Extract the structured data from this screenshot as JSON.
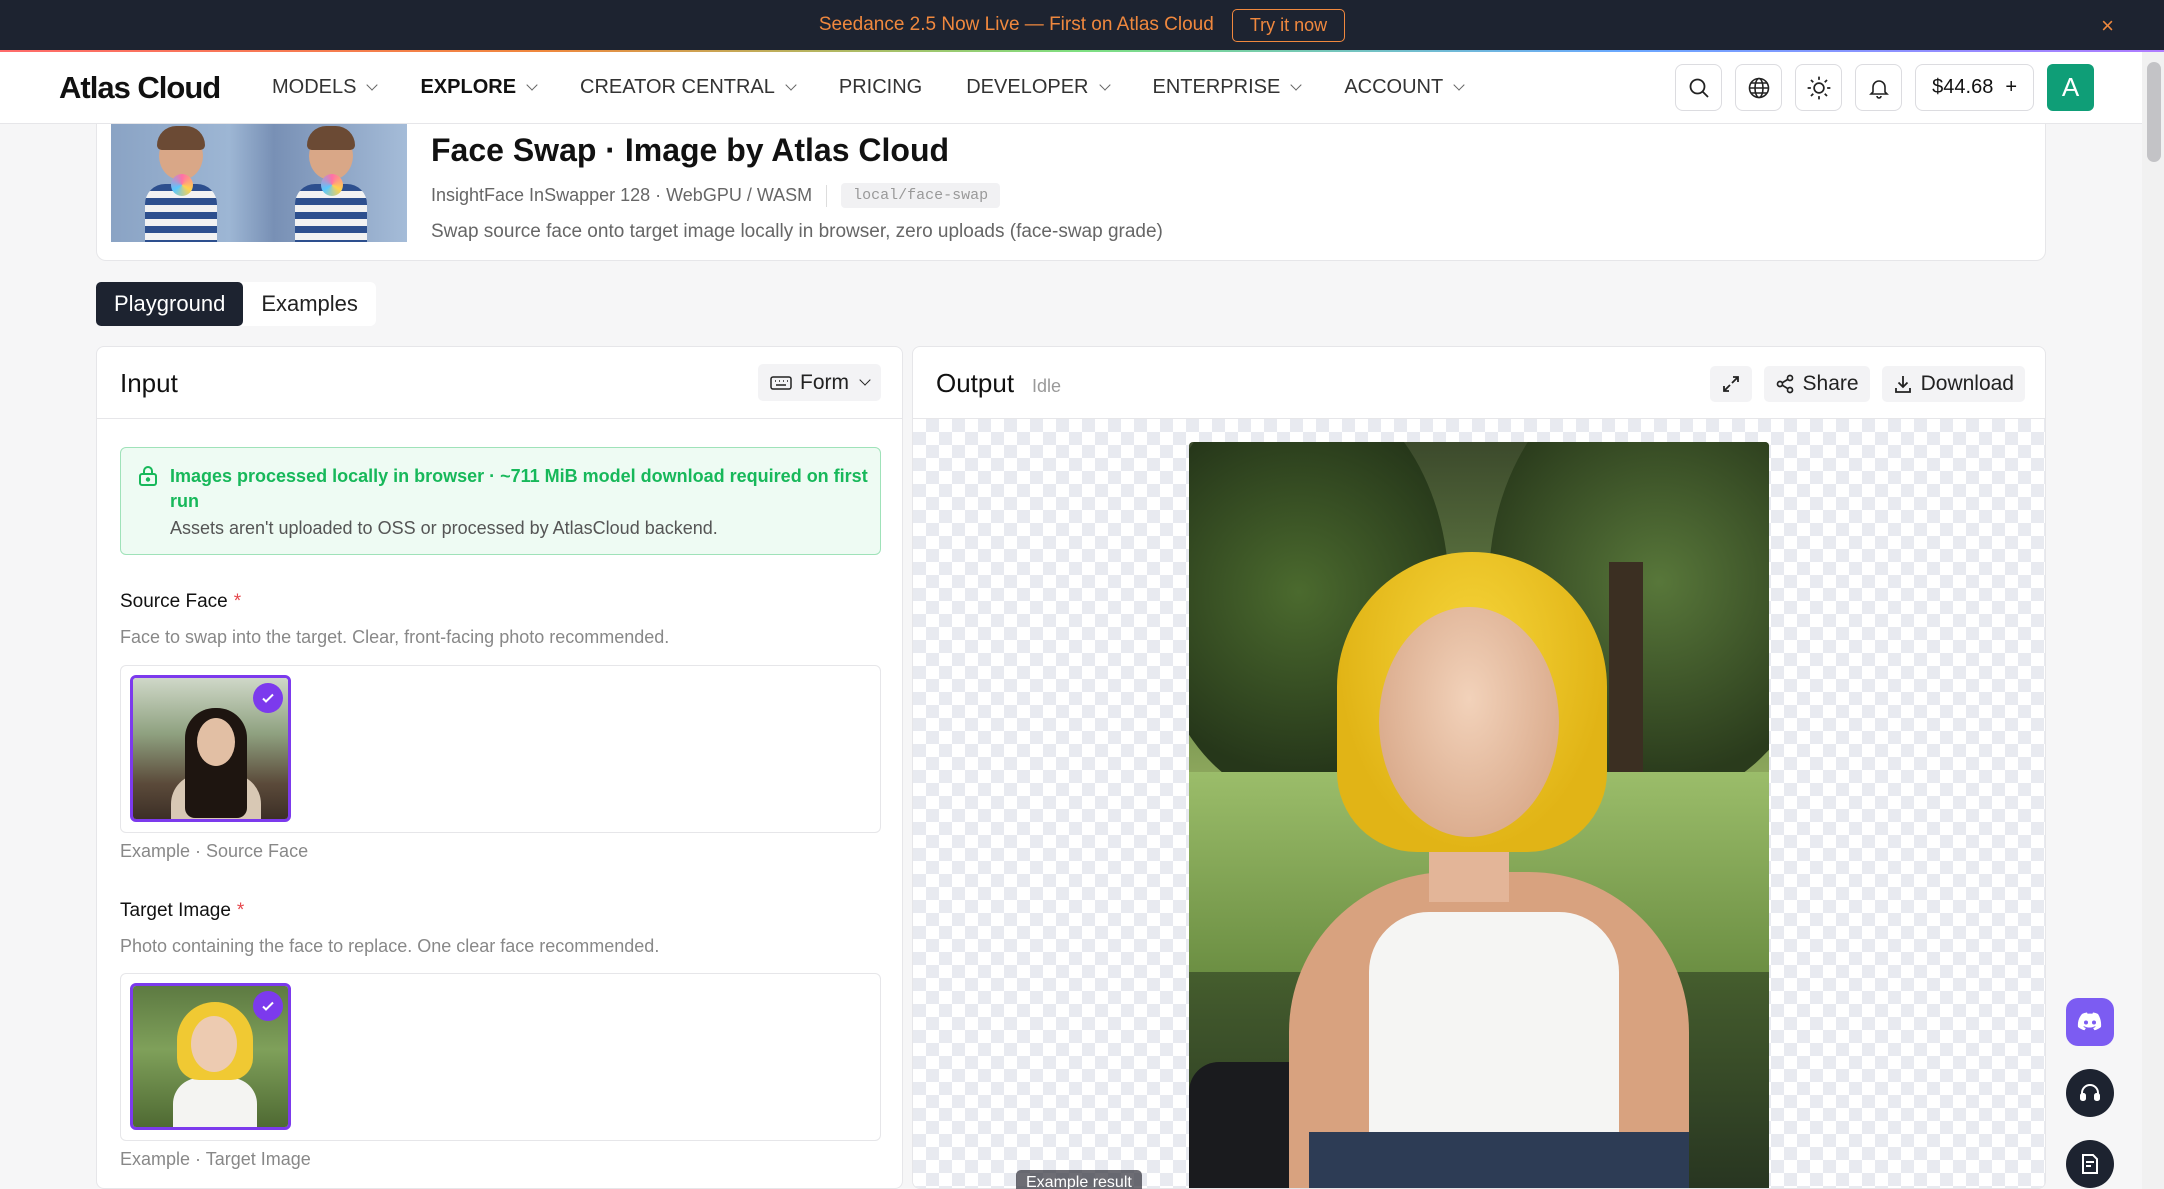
{
  "announcement": {
    "message": "Seedance 2.5 Now Live — First on Atlas Cloud",
    "cta": "Try it now",
    "close": "×"
  },
  "nav": {
    "logo": "Atlas Cloud",
    "items": [
      {
        "label": "MODELS",
        "dropdown": true
      },
      {
        "label": "EXPLORE",
        "dropdown": true,
        "active": true
      },
      {
        "label": "CREATOR CENTRAL",
        "dropdown": true
      },
      {
        "label": "PRICING",
        "dropdown": false
      },
      {
        "label": "DEVELOPER",
        "dropdown": true
      },
      {
        "label": "ENTERPRISE",
        "dropdown": true
      },
      {
        "label": "ACCOUNT",
        "dropdown": true
      }
    ],
    "balance": "$44.68",
    "balance_add": "+",
    "avatar_initial": "A"
  },
  "model": {
    "title": "Face Swap · Image by Atlas Cloud",
    "meta": "InsightFace InSwapper 128 · WebGPU / WASM",
    "slug": "local/face-swap",
    "description": "Swap source face onto target image locally in browser, zero uploads (face-swap grade)"
  },
  "tabs": [
    "Playground",
    "Examples"
  ],
  "input": {
    "title": "Input",
    "mode_button": "Form",
    "notice_title": "Images processed locally in browser · ~711 MiB model download required on first run",
    "notice_body": "Assets aren't uploaded to OSS or processed by AtlasCloud backend.",
    "source_face": {
      "label": "Source Face",
      "required": "*",
      "help": "Face to swap into the target. Clear, front-facing photo recommended.",
      "caption": "Example · Source Face"
    },
    "target_image": {
      "label": "Target Image",
      "required": "*",
      "help": "Photo containing the face to replace. One clear face recommended.",
      "caption": "Example · Target Image"
    }
  },
  "output": {
    "title": "Output",
    "status": "Idle",
    "share": "Share",
    "download": "Download",
    "example_tag": "Example result"
  },
  "colors": {
    "accent": "#7c3aed",
    "nav_dark": "#1d2330",
    "announce": "#f0883e",
    "success": "#17b85a",
    "avatar": "#0f9e77"
  }
}
